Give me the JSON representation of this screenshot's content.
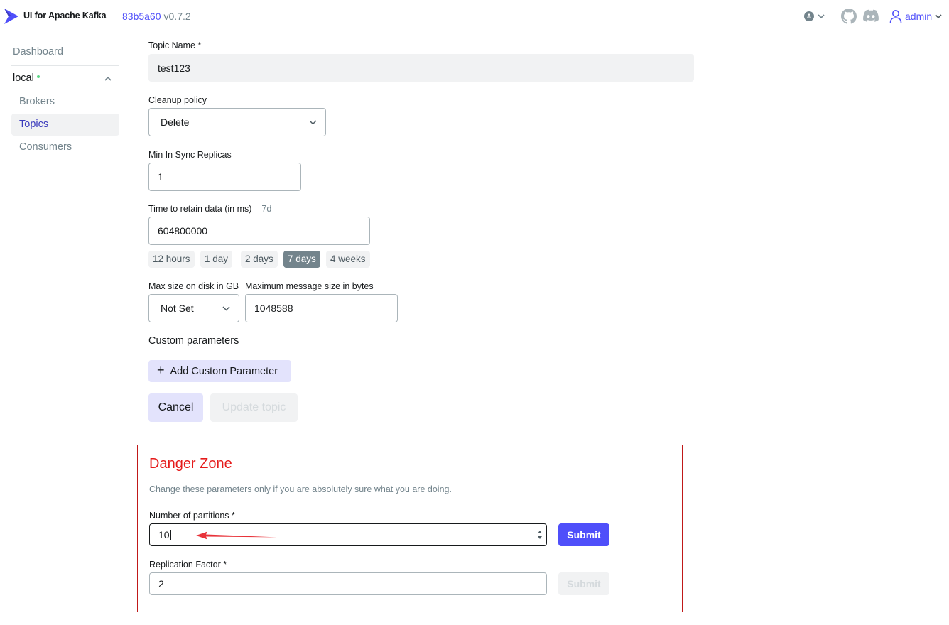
{
  "header": {
    "app_title": "UI for Apache Kafka",
    "commit_hash": "83b5a60",
    "version": "v0.7.2",
    "theme_badge": "A",
    "user": "admin",
    "brand_color": "#4f4ffa"
  },
  "sidebar": {
    "dashboard": "Dashboard",
    "cluster": "local",
    "cluster_status_color": "#5cd685",
    "items": [
      {
        "label": "Brokers",
        "active": false
      },
      {
        "label": "Topics",
        "active": true
      },
      {
        "label": "Consumers",
        "active": false
      }
    ]
  },
  "form": {
    "topic_name": {
      "label": "Topic Name *",
      "value": "test123"
    },
    "cleanup_policy": {
      "label": "Cleanup policy",
      "value": "Delete"
    },
    "min_isr": {
      "label": "Min In Sync Replicas",
      "value": "1"
    },
    "retention": {
      "label": "Time to retain data (in ms)",
      "hint": "7d",
      "value": "604800000",
      "presets": [
        "12 hours",
        "1 day",
        "2 days",
        "7 days",
        "4 weeks"
      ],
      "selected_preset": "7 days"
    },
    "max_disk": {
      "label": "Max size on disk in GB",
      "value": "Not Set"
    },
    "max_message": {
      "label": "Maximum message size in bytes",
      "value": "1048588"
    },
    "custom_params_title": "Custom parameters",
    "add_custom_param": "Add Custom Parameter",
    "cancel": "Cancel",
    "update": "Update topic"
  },
  "danger_zone": {
    "title": "Danger Zone",
    "description": "Change these parameters only if you are absolutely sure what you are doing.",
    "partitions": {
      "label": "Number of partitions *",
      "value": "10",
      "submit": "Submit"
    },
    "replication": {
      "label": "Replication Factor *",
      "value": "2",
      "submit": "Submit"
    },
    "border_color": "#c01919",
    "title_color": "#e51a1a"
  }
}
